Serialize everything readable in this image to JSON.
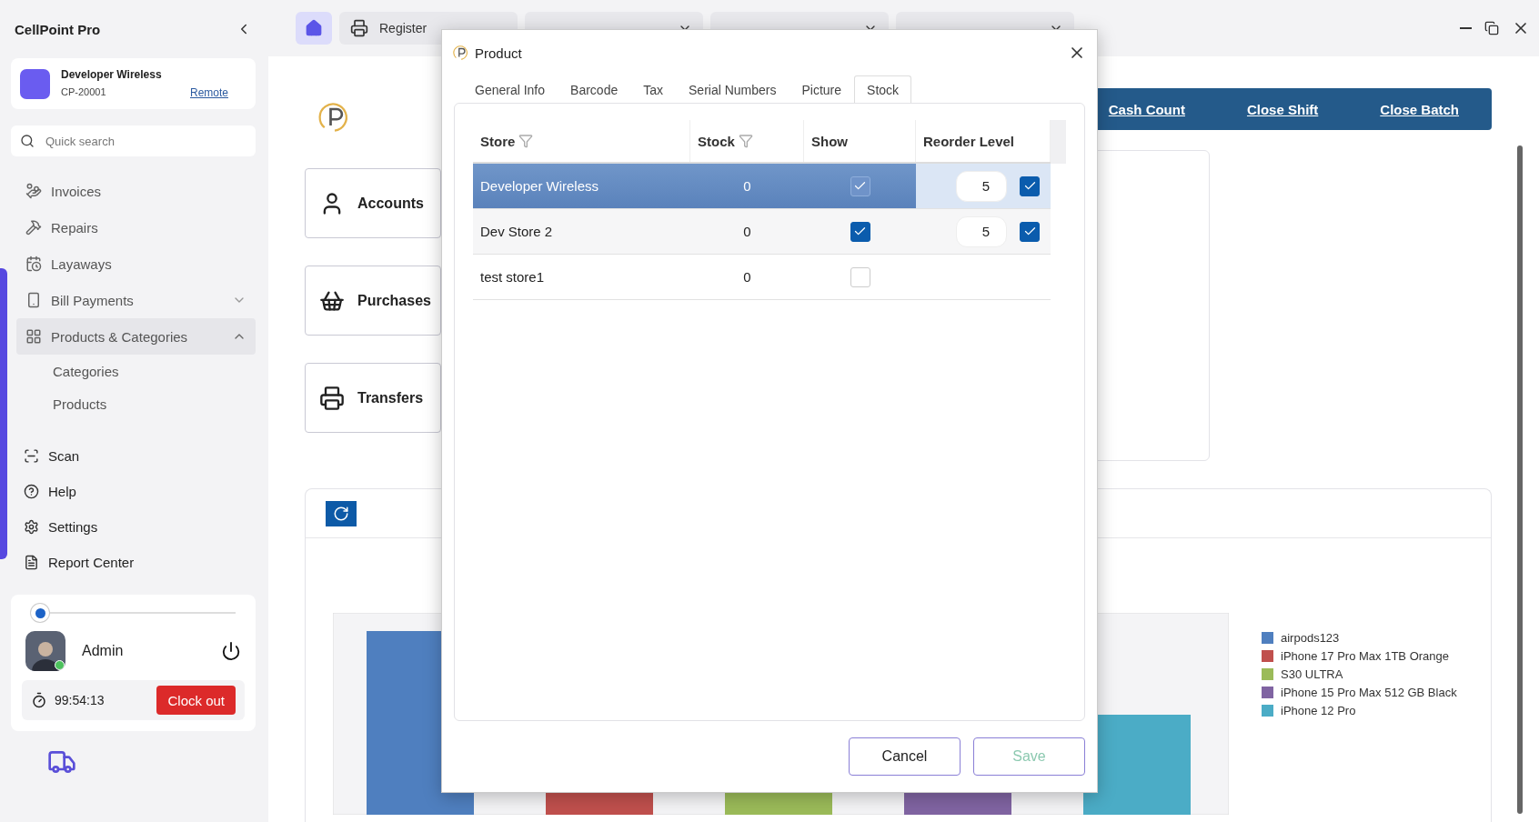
{
  "app": {
    "title": "CellPoint Pro"
  },
  "account": {
    "name": "Developer Wireless",
    "code": "CP-20001",
    "link": "Remote"
  },
  "search": {
    "placeholder": "Quick search"
  },
  "nav": [
    {
      "label": "Invoices",
      "selected": false
    },
    {
      "label": "Repairs",
      "selected": false
    },
    {
      "label": "Layaways",
      "selected": false
    },
    {
      "label": "Bill Payments",
      "selected": false,
      "expanded": false
    },
    {
      "label": "Products & Categories",
      "selected": true,
      "expanded": true,
      "children": [
        {
          "label": "Categories"
        },
        {
          "label": "Products"
        }
      ]
    }
  ],
  "nav_bottom": [
    {
      "label": "Scan"
    },
    {
      "label": "Help"
    },
    {
      "label": "Settings"
    },
    {
      "label": "Report Center"
    }
  ],
  "user": {
    "name": "Admin",
    "slider": {
      "level": 0
    },
    "timer": "99:54:13",
    "clock_button": "Clock out"
  },
  "top_tabs": [
    {
      "kind": "home",
      "selected": true
    },
    {
      "kind": "labeled",
      "label": "Register",
      "selected": false
    },
    {
      "kind": "covered",
      "selected": false
    },
    {
      "kind": "covered",
      "selected": false
    },
    {
      "kind": "covered",
      "selected": false
    }
  ],
  "tiles": [
    {
      "label": "Accounts"
    },
    {
      "label": "Purchases"
    },
    {
      "label": "Transfers"
    }
  ],
  "actions": [
    "Cash Count",
    "Close Shift",
    "Close Batch"
  ],
  "legend": [
    {
      "label": "airpods123",
      "color": "#4f7fbf"
    },
    {
      "label": "iPhone 17 Pro Max 1TB Orange",
      "color": "#c0504d"
    },
    {
      "label": "S30 ULTRA",
      "color": "#9bbb59"
    },
    {
      "label": "iPhone 15 Pro Max 512 GB Black",
      "color": "#8064a2"
    },
    {
      "label": "iPhone 12 Pro",
      "color": "#4bacc6"
    }
  ],
  "dialog": {
    "title": "Product",
    "tabs": [
      {
        "label": "General Info",
        "selected": false
      },
      {
        "label": "Barcode",
        "selected": false
      },
      {
        "label": "Tax",
        "selected": false
      },
      {
        "label": "Serial Numbers",
        "selected": false
      },
      {
        "label": "Picture",
        "selected": false
      },
      {
        "label": "Stock",
        "selected": true
      }
    ],
    "columns": [
      "Store",
      "Stock",
      "Show",
      "Reorder Level"
    ],
    "rows": [
      {
        "store": "Developer Wireless",
        "stock": "0",
        "show": true,
        "selected": true,
        "reorder": {
          "value": "5",
          "checked": true
        }
      },
      {
        "store": "Dev Store 2",
        "stock": "0",
        "show": true,
        "selected": false,
        "reorder": {
          "value": "5",
          "checked": true
        }
      },
      {
        "store": "test store1",
        "stock": "0",
        "show": false,
        "selected": false
      }
    ],
    "buttons": [
      {
        "label": "Cancel",
        "disabled": false
      },
      {
        "label": "Save",
        "disabled": true
      }
    ]
  }
}
